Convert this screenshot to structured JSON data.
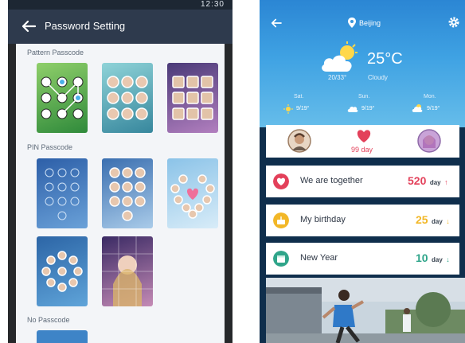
{
  "left_screen": {
    "status_time": "12:30",
    "title": "Password Setting",
    "sections": {
      "pattern": "Pattern Passcode",
      "pin": "PIN Passcode",
      "none": "No Passcode"
    },
    "icons": [
      "back-arrow-icon"
    ]
  },
  "right_screen": {
    "city": "Beijing",
    "temperature": "25°C",
    "range": "20/33°",
    "condition": "Cloudy",
    "forecast": [
      {
        "day": "Sat.",
        "temp": "9/19°",
        "icon": "sun-icon"
      },
      {
        "day": "Sun.",
        "temp": "9/19°",
        "icon": "cloud-icon"
      },
      {
        "day": "Mon.",
        "temp": "9/19°",
        "icon": "partly-cloudy-icon"
      }
    ],
    "couple_days": "99 day",
    "anniversaries": [
      {
        "label": "We are together",
        "number": "520",
        "unit": "day",
        "arrow": "↑",
        "color": "#e3405a",
        "icon": "heart-icon"
      },
      {
        "label": "My birthday",
        "number": "25",
        "unit": "day",
        "arrow": "↓",
        "color": "#f2b727",
        "icon": "cake-icon"
      },
      {
        "label": "New Year",
        "number": "10",
        "unit": "day",
        "arrow": "↓",
        "color": "#2fa58a",
        "icon": "calendar-icon"
      }
    ],
    "accent_colors": {
      "red": "#e3405a",
      "yellow": "#f2b727",
      "teal": "#2fa58a",
      "sky": "#3fa2e3"
    }
  }
}
